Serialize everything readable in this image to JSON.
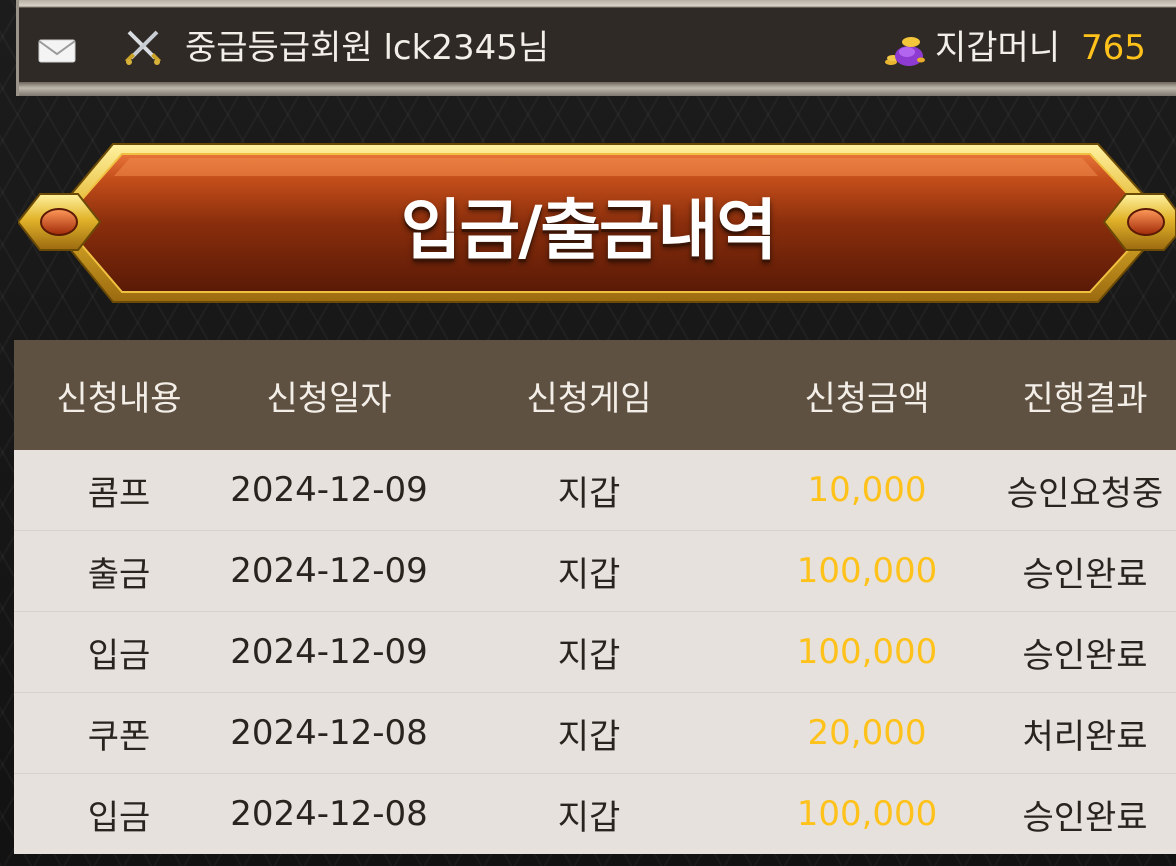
{
  "header": {
    "member_text": "중급등급회원 lck2345님",
    "wallet_label": "지갑머니",
    "wallet_value": "765",
    "icons": {
      "mail": "mail-icon",
      "rank": "crossed-swords-icon",
      "wallet": "money-bag-icon"
    }
  },
  "title": "입금/출금내역",
  "table": {
    "columns": [
      "신청내용",
      "신청일자",
      "신청게임",
      "신청금액",
      "진행결과"
    ],
    "rows": [
      [
        "콤프",
        "2024-12-09",
        "지갑",
        "10,000",
        "승인요청중"
      ],
      [
        "출금",
        "2024-12-09",
        "지갑",
        "100,000",
        "승인완료"
      ],
      [
        "입금",
        "2024-12-09",
        "지갑",
        "100,000",
        "승인완료"
      ],
      [
        "쿠폰",
        "2024-12-08",
        "지갑",
        "20,000",
        "처리완료"
      ],
      [
        "입금",
        "2024-12-08",
        "지갑",
        "100,000",
        "승인완료"
      ]
    ]
  },
  "colors": {
    "accent_gold": "#ffc21a",
    "header_bg": "#5f5142",
    "row_bg": "#e6e1dc",
    "banner_red": "#8a2e0c"
  }
}
